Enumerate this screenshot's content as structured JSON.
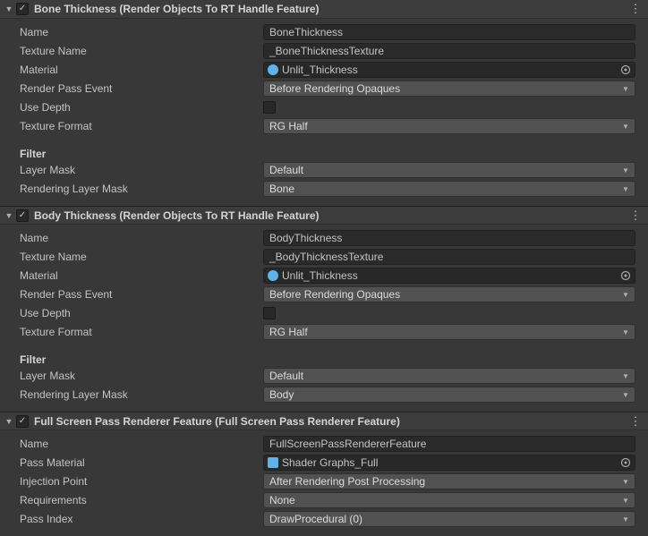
{
  "sections": [
    {
      "title": "Bone Thickness (Render Objects To RT Handle Feature)",
      "enabled": true,
      "name_label": "Name",
      "name_value": "BoneThickness",
      "texture_name_label": "Texture Name",
      "texture_name_value": "_BoneThicknessTexture",
      "material_label": "Material",
      "material_value": "Unlit_Thickness",
      "render_pass_event_label": "Render Pass Event",
      "render_pass_event_value": "Before Rendering Opaques",
      "use_depth_label": "Use Depth",
      "use_depth_value": false,
      "texture_format_label": "Texture Format",
      "texture_format_value": "RG Half",
      "filter_label": "Filter",
      "layer_mask_label": "Layer Mask",
      "layer_mask_value": "Default",
      "rendering_layer_mask_label": "Rendering Layer Mask",
      "rendering_layer_mask_value": "Bone"
    },
    {
      "title": "Body Thickness (Render Objects To RT Handle Feature)",
      "enabled": true,
      "name_label": "Name",
      "name_value": "BodyThickness",
      "texture_name_label": "Texture Name",
      "texture_name_value": "_BodyThicknessTexture",
      "material_label": "Material",
      "material_value": "Unlit_Thickness",
      "render_pass_event_label": "Render Pass Event",
      "render_pass_event_value": "Before Rendering Opaques",
      "use_depth_label": "Use Depth",
      "use_depth_value": false,
      "texture_format_label": "Texture Format",
      "texture_format_value": "RG Half",
      "filter_label": "Filter",
      "layer_mask_label": "Layer Mask",
      "layer_mask_value": "Default",
      "rendering_layer_mask_label": "Rendering Layer Mask",
      "rendering_layer_mask_value": "Body"
    },
    {
      "title": "Full Screen Pass Renderer Feature (Full Screen Pass Renderer Feature)",
      "enabled": true,
      "name_label": "Name",
      "name_value": "FullScreenPassRendererFeature",
      "pass_material_label": "Pass Material",
      "pass_material_value": "Shader Graphs_Full",
      "injection_point_label": "Injection Point",
      "injection_point_value": "After Rendering Post Processing",
      "requirements_label": "Requirements",
      "requirements_value": "None",
      "pass_index_label": "Pass Index",
      "pass_index_value": "DrawProcedural (0)"
    }
  ]
}
